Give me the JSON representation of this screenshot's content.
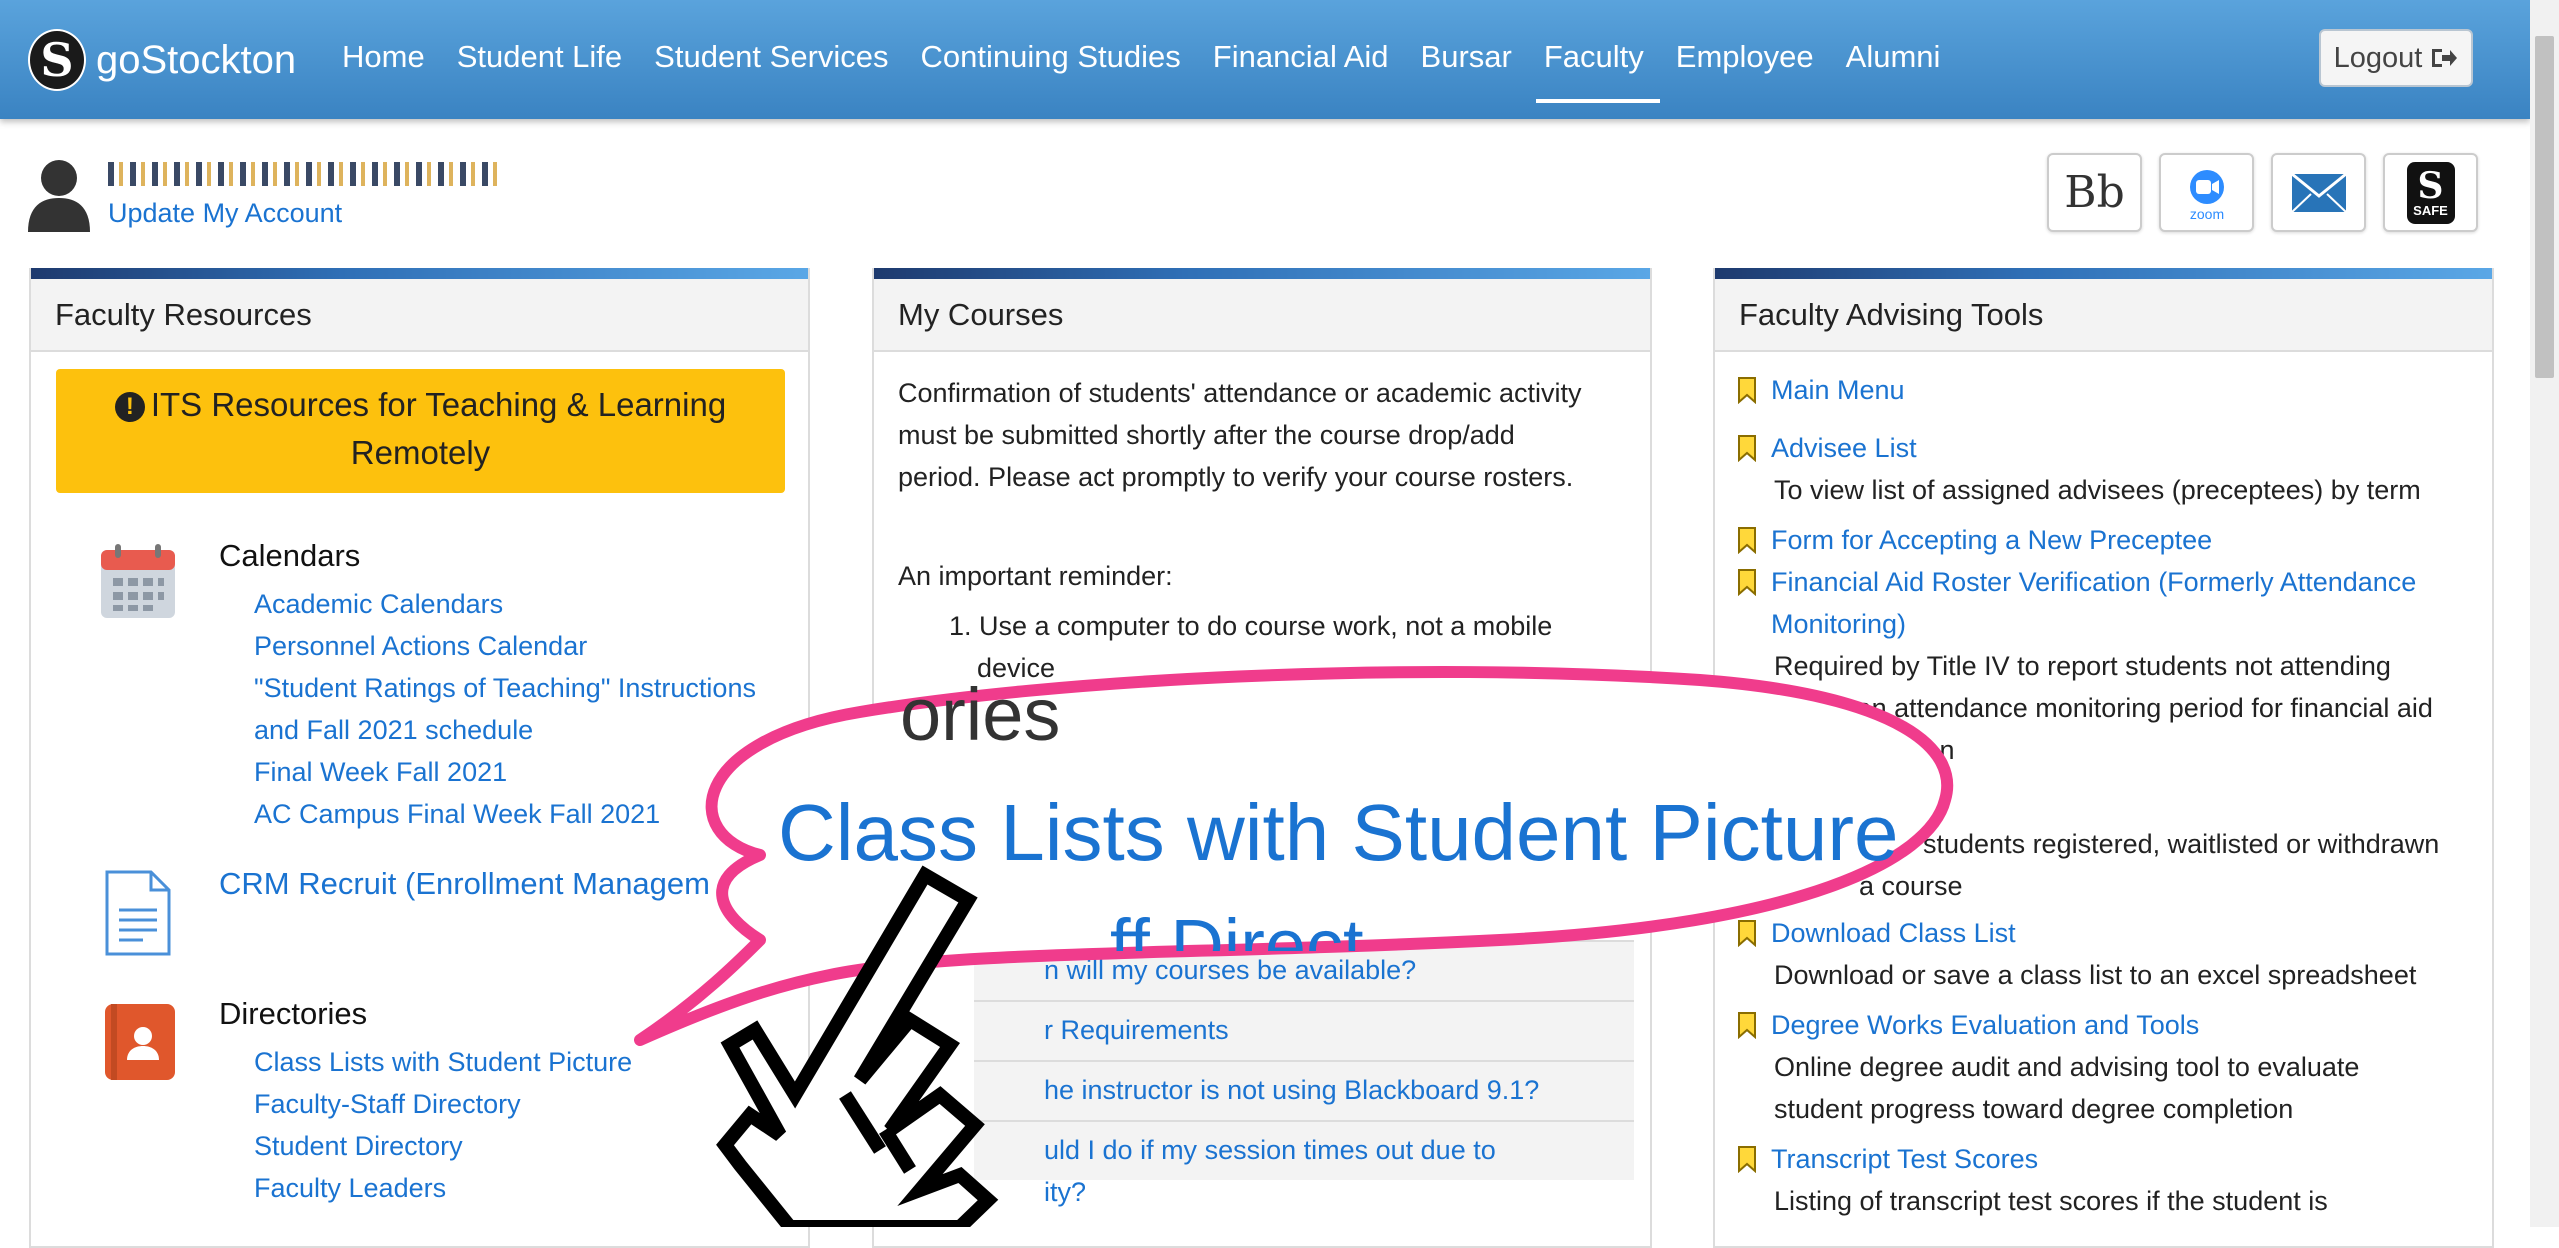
{
  "brand": {
    "name": "goStockton",
    "logo_letter": "S"
  },
  "nav": {
    "items": [
      "Home",
      "Student Life",
      "Student Services",
      "Continuing Studies",
      "Financial Aid",
      "Bursar",
      "Faculty",
      "Employee",
      "Alumni"
    ],
    "active": "Faculty",
    "logout_label": "Logout"
  },
  "user": {
    "update_link": "Update My Account"
  },
  "quick_links": {
    "blackboard": "Bb",
    "zoom": "zoom",
    "safe_letter": "S",
    "safe_label": "SAFE"
  },
  "faculty_resources": {
    "title": "Faculty Resources",
    "its_banner": "ITS Resources for Teaching & Learning Remotely",
    "calendars": {
      "title": "Calendars",
      "links": [
        "Academic Calendars",
        "Personnel Actions Calendar",
        "\"Student Ratings of Teaching\" Instructions",
        "and Fall 2021 schedule",
        "Final Week Fall 2021",
        "AC Campus Final Week Fall 2021"
      ]
    },
    "crm": {
      "title": "CRM Recruit (Enrollment Managem"
    },
    "directories": {
      "title": "Directories",
      "links": [
        "Class Lists with Student Picture",
        "Faculty-Staff Directory",
        "Student Directory",
        "Faculty Leaders"
      ]
    }
  },
  "my_courses": {
    "title": "My Courses",
    "intro": [
      "Confirmation of students' attendance or academic activity",
      "must be submitted shortly after the course drop/add",
      "period.  Please act promptly to verify your course rosters."
    ],
    "reminder_label": "An important reminder:",
    "reminder_item_1": [
      "1. Use a computer to do course work, not a mobile",
      "device"
    ],
    "faq": [
      "n will my courses be available?",
      "r Requirements",
      "he instructor is not using Blackboard 9.1?",
      "uld I do if my session times out due to",
      "ity?"
    ]
  },
  "advising": {
    "title": "Faculty Advising Tools",
    "items": [
      {
        "link": "Main Menu",
        "desc": ""
      },
      {
        "link": "Advisee List",
        "desc": "To view list of assigned advisees (preceptees) by term"
      },
      {
        "link": "Form for Accepting a New Preceptee",
        "desc": ""
      },
      {
        "link": "Financial Aid Roster Verification (Formerly Attendance",
        "link2": "Monitoring)",
        "desc": "Required by Title IV to report students not attending",
        "desc2": "during an attendance monitoring period for financial aid",
        "desc3": "distribution"
      },
      {
        "desc": "students registered, waitlisted or withdrawn",
        "desc2": "a course"
      },
      {
        "link": "Download Class List",
        "desc": "Download or save a class list to an excel spreadsheet"
      },
      {
        "link": "Degree Works Evaluation and Tools",
        "desc": "Online degree audit and advising tool to evaluate",
        "desc2": "student progress toward degree completion"
      },
      {
        "link": "Transcript Test Scores",
        "desc": "Listing of transcript test scores if the student is"
      }
    ]
  },
  "zoom_callout": {
    "text": "Class Lists with Student Picture",
    "ghost_top": "ories",
    "ghost_bottom": "ff Direct"
  },
  "colors": {
    "nav": "#3a83c2",
    "link": "#1a73d1",
    "banner": "#fdc10d",
    "callout": "#f03c8c"
  }
}
